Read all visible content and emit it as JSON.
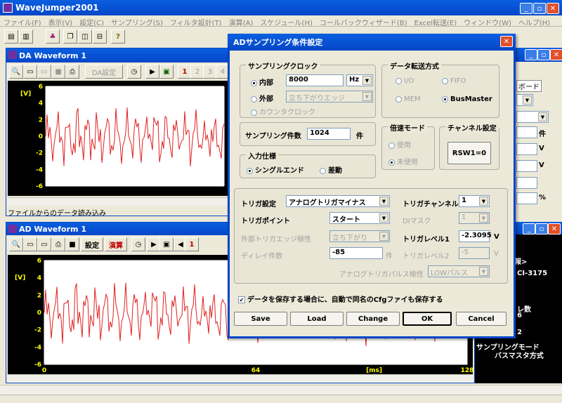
{
  "app": {
    "title": "WaveJumper2001"
  },
  "menu": [
    "ファイル(F)",
    "表示(V)",
    "設定(C)",
    "サンプリング(S)",
    "フィルタ設計(T)",
    "演算(A)",
    "スケジュール(H)",
    "コールバックウィザード(B)",
    "Excel転送(E)",
    "ウィンドウ(W)",
    "ヘルプ(H)"
  ],
  "da_window": {
    "title": "DA Waveform 1",
    "settings_label": "DA設定",
    "page_numbers": [
      "1",
      "2",
      "3",
      "4"
    ],
    "y_unit": "[V]",
    "y_ticks": [
      "6",
      "4",
      "2",
      "0",
      "-2",
      "-4",
      "-6"
    ],
    "status": "ファイルからのデータ読み込み"
  },
  "ad_window": {
    "title": "AD Waveform 1",
    "settings_label": "設定",
    "calc_label": "演算",
    "page_number": "1",
    "y_unit": "[V]",
    "y_ticks": [
      "6",
      "4",
      "2",
      "0",
      "-2",
      "-4",
      "-6"
    ],
    "x_ticks": [
      "0",
      "64",
      "[ms]",
      "128"
    ]
  },
  "right_panel": {
    "tab_label": "ボード",
    "unit_ken": "件",
    "unit_v1": "V",
    "unit_v2": "V",
    "unit_pct": "%",
    "info_header": "報>",
    "board_model": "CI-3175",
    "cnt_label": "レ数",
    "cnt_value": "6",
    "val2": "2",
    "mode_label": "サンプリングモード",
    "mode_value": "バスマスタ方式"
  },
  "dialog": {
    "title": "ADサンプリング条件設定",
    "clock_group": "サンプリングクロック",
    "internal_label": "内部",
    "internal_freq": "8000",
    "freq_unit": "Hz",
    "external_label": "外部",
    "external_edge": "立ち下がりエッジ",
    "counter_clock_label": "カウンタクロック",
    "transfer_group": "データ転送方式",
    "transfer_io": "I/O",
    "transfer_fifo": "FIFO",
    "transfer_mem": "MEM",
    "transfer_busmaster": "BusMaster",
    "samples_label": "サンプリング件数",
    "samples_value": "1024",
    "samples_unit": "件",
    "speed_group": "倍速モード",
    "speed_use": "使用",
    "speed_nouse": "未使用",
    "channel_group": "チャンネル設定",
    "channel_button": "RSW1=0",
    "input_group": "入力仕様",
    "input_single": "シングルエンド",
    "input_diff": "差動",
    "trigger_setting_label": "トリガ設定",
    "trigger_setting_value": "アナログトリガマイナス",
    "trigger_channel_label": "トリガチャンネル",
    "trigger_channel_value": "1",
    "trigger_point_label": "トリガポイント",
    "trigger_point_value": "スタート",
    "di_mask_label": "DIマスク",
    "di_mask_value": "1",
    "ext_edge_label": "外部トリガエッジ極性",
    "ext_edge_value": "立ち下がり",
    "trigger_level1_label": "トリガレベル1",
    "trigger_level1_value": "-2.3095",
    "level1_unit": "V",
    "delay_label": "ディレイ件数",
    "delay_value": "-85",
    "delay_unit": "件",
    "trigger_level2_label": "トリガレベル2",
    "trigger_level2_value": "-5",
    "level2_unit": "V",
    "pulse_label": "アナログトリガパルス極性",
    "pulse_value": "LOWパルス",
    "save_cfg_label": "データを保存する場合に、自動で同名のCfgファイも保存する",
    "buttons": {
      "save": "Save",
      "load": "Load",
      "change": "Change",
      "ok": "OK",
      "cancel": "Cancel"
    }
  },
  "colors": {
    "accent": "#0546c8",
    "plot_bg": "#000000",
    "wave": "#e02020",
    "axis_text": "#ffff00"
  }
}
